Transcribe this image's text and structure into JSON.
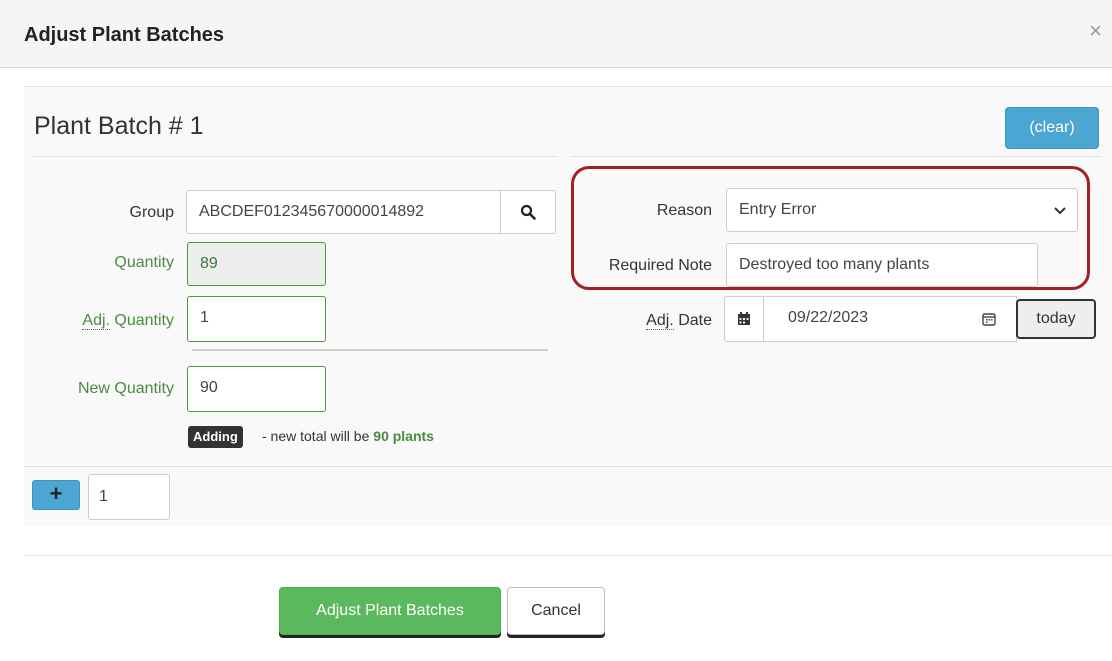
{
  "modal": {
    "title": "Adjust Plant Batches",
    "close_glyph": "×"
  },
  "batch": {
    "title": "Plant Batch # 1",
    "clear_label": "(clear)"
  },
  "form": {
    "group_label": "Group",
    "group_value": "ABCDEF012345670000014892",
    "quantity_label": "Quantity",
    "quantity_value": "89",
    "adj_abbr": "Adj.",
    "adj_quantity_label_rest": " Quantity",
    "adj_quantity_value": "1",
    "new_quantity_label": "New Quantity",
    "new_quantity_value": "90",
    "badge_label": "Adding",
    "summary_prefix": " - new total will be ",
    "summary_total": "90 plants",
    "reason_label": "Reason",
    "reason_value": "Entry Error",
    "note_label": "Required Note",
    "note_value": "Destroyed too many plants",
    "adj_date_label_rest": " Date",
    "adj_date_value": "09/22/2023",
    "today_label": "today"
  },
  "batch_controls": {
    "add_glyph": "+",
    "count_value": "1"
  },
  "footer": {
    "submit_label": "Adjust Plant Batches",
    "cancel_label": "Cancel"
  },
  "colors": {
    "accent_blue": "#4ba6d1",
    "success_green": "#5cb85c",
    "label_green": "#4a8c3f",
    "highlight_red": "#a31f24"
  },
  "icons": [
    "search-icon",
    "calendar-icon",
    "calendar-picker-icon",
    "chevron-down-icon",
    "close-icon",
    "plus-icon"
  ]
}
